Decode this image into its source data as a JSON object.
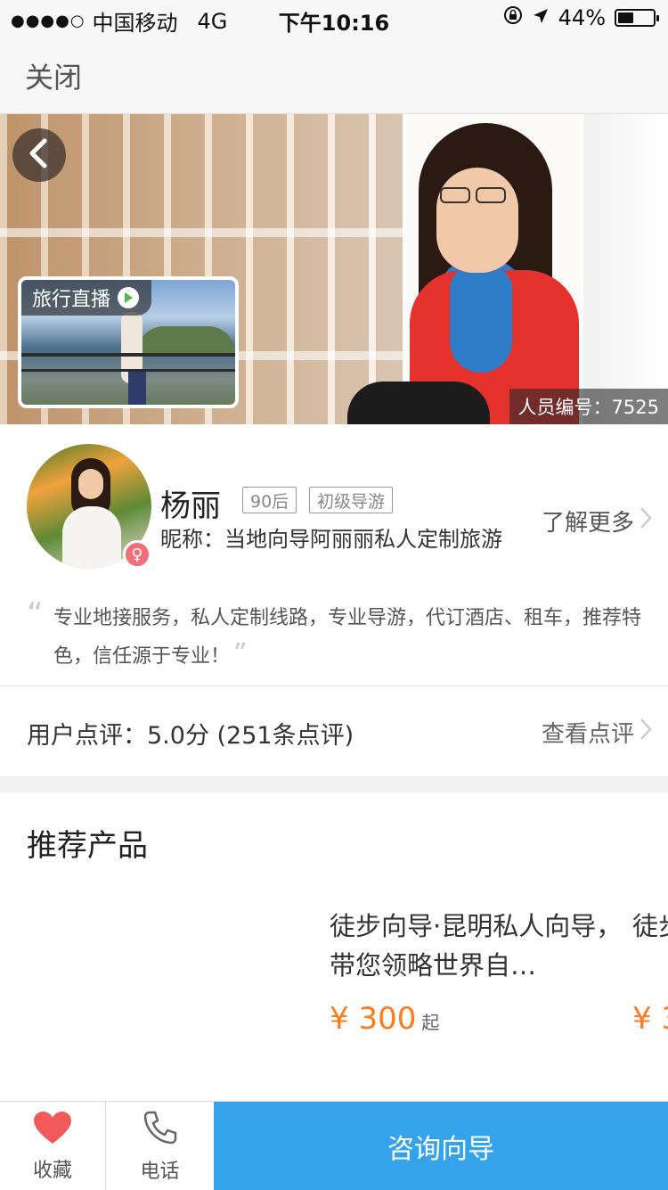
{
  "status_bar": {
    "signal": "●●●●○",
    "carrier": "中国移动",
    "network": "4G",
    "time": "下午10:16",
    "battery": "44%",
    "battery_level": 0.44
  },
  "nav": {
    "close_label": "关闭"
  },
  "hero": {
    "live_tag": "旅行直播",
    "staff_no": "人员编号：7525"
  },
  "profile": {
    "name": "杨丽",
    "badges": [
      "90后",
      "初级导游"
    ],
    "nickname": "昵称：当地向导阿丽丽私人定制旅游",
    "more_label": "了解更多",
    "gender_symbol": "♀",
    "intro_open_quote": "“",
    "intro": "专业地接服务，私人定制线路，专业导游，代订酒店、租车，推荐特色，信任源于专业！",
    "intro_close_quote": "”"
  },
  "review": {
    "label": "用户点评：5.0分 (251条点评)",
    "link": "查看点评"
  },
  "products": {
    "title": "推荐产品",
    "items": [
      {
        "name": "徒步向导·昆明私人向导，带您领略世界自…",
        "currency": "¥",
        "price": "300",
        "unit": "起"
      },
      {
        "name": "徒步向导，",
        "currency": "¥",
        "price": "3",
        "unit": ""
      }
    ]
  },
  "bottom": {
    "favorite_label": "收藏",
    "phone_label": "电话",
    "consult_label": "咨询向导"
  },
  "colors": {
    "accent_blue": "#35a3ea",
    "price_orange": "#ff7a1a",
    "heart_red": "#f25a5a",
    "gender_pink": "#f36d78"
  },
  "icons": [
    "back-arrow-icon",
    "play-icon",
    "chevron-right-icon",
    "heart-icon",
    "phone-icon",
    "female-icon",
    "lock-rotation-icon",
    "location-arrow-icon",
    "battery-icon"
  ]
}
